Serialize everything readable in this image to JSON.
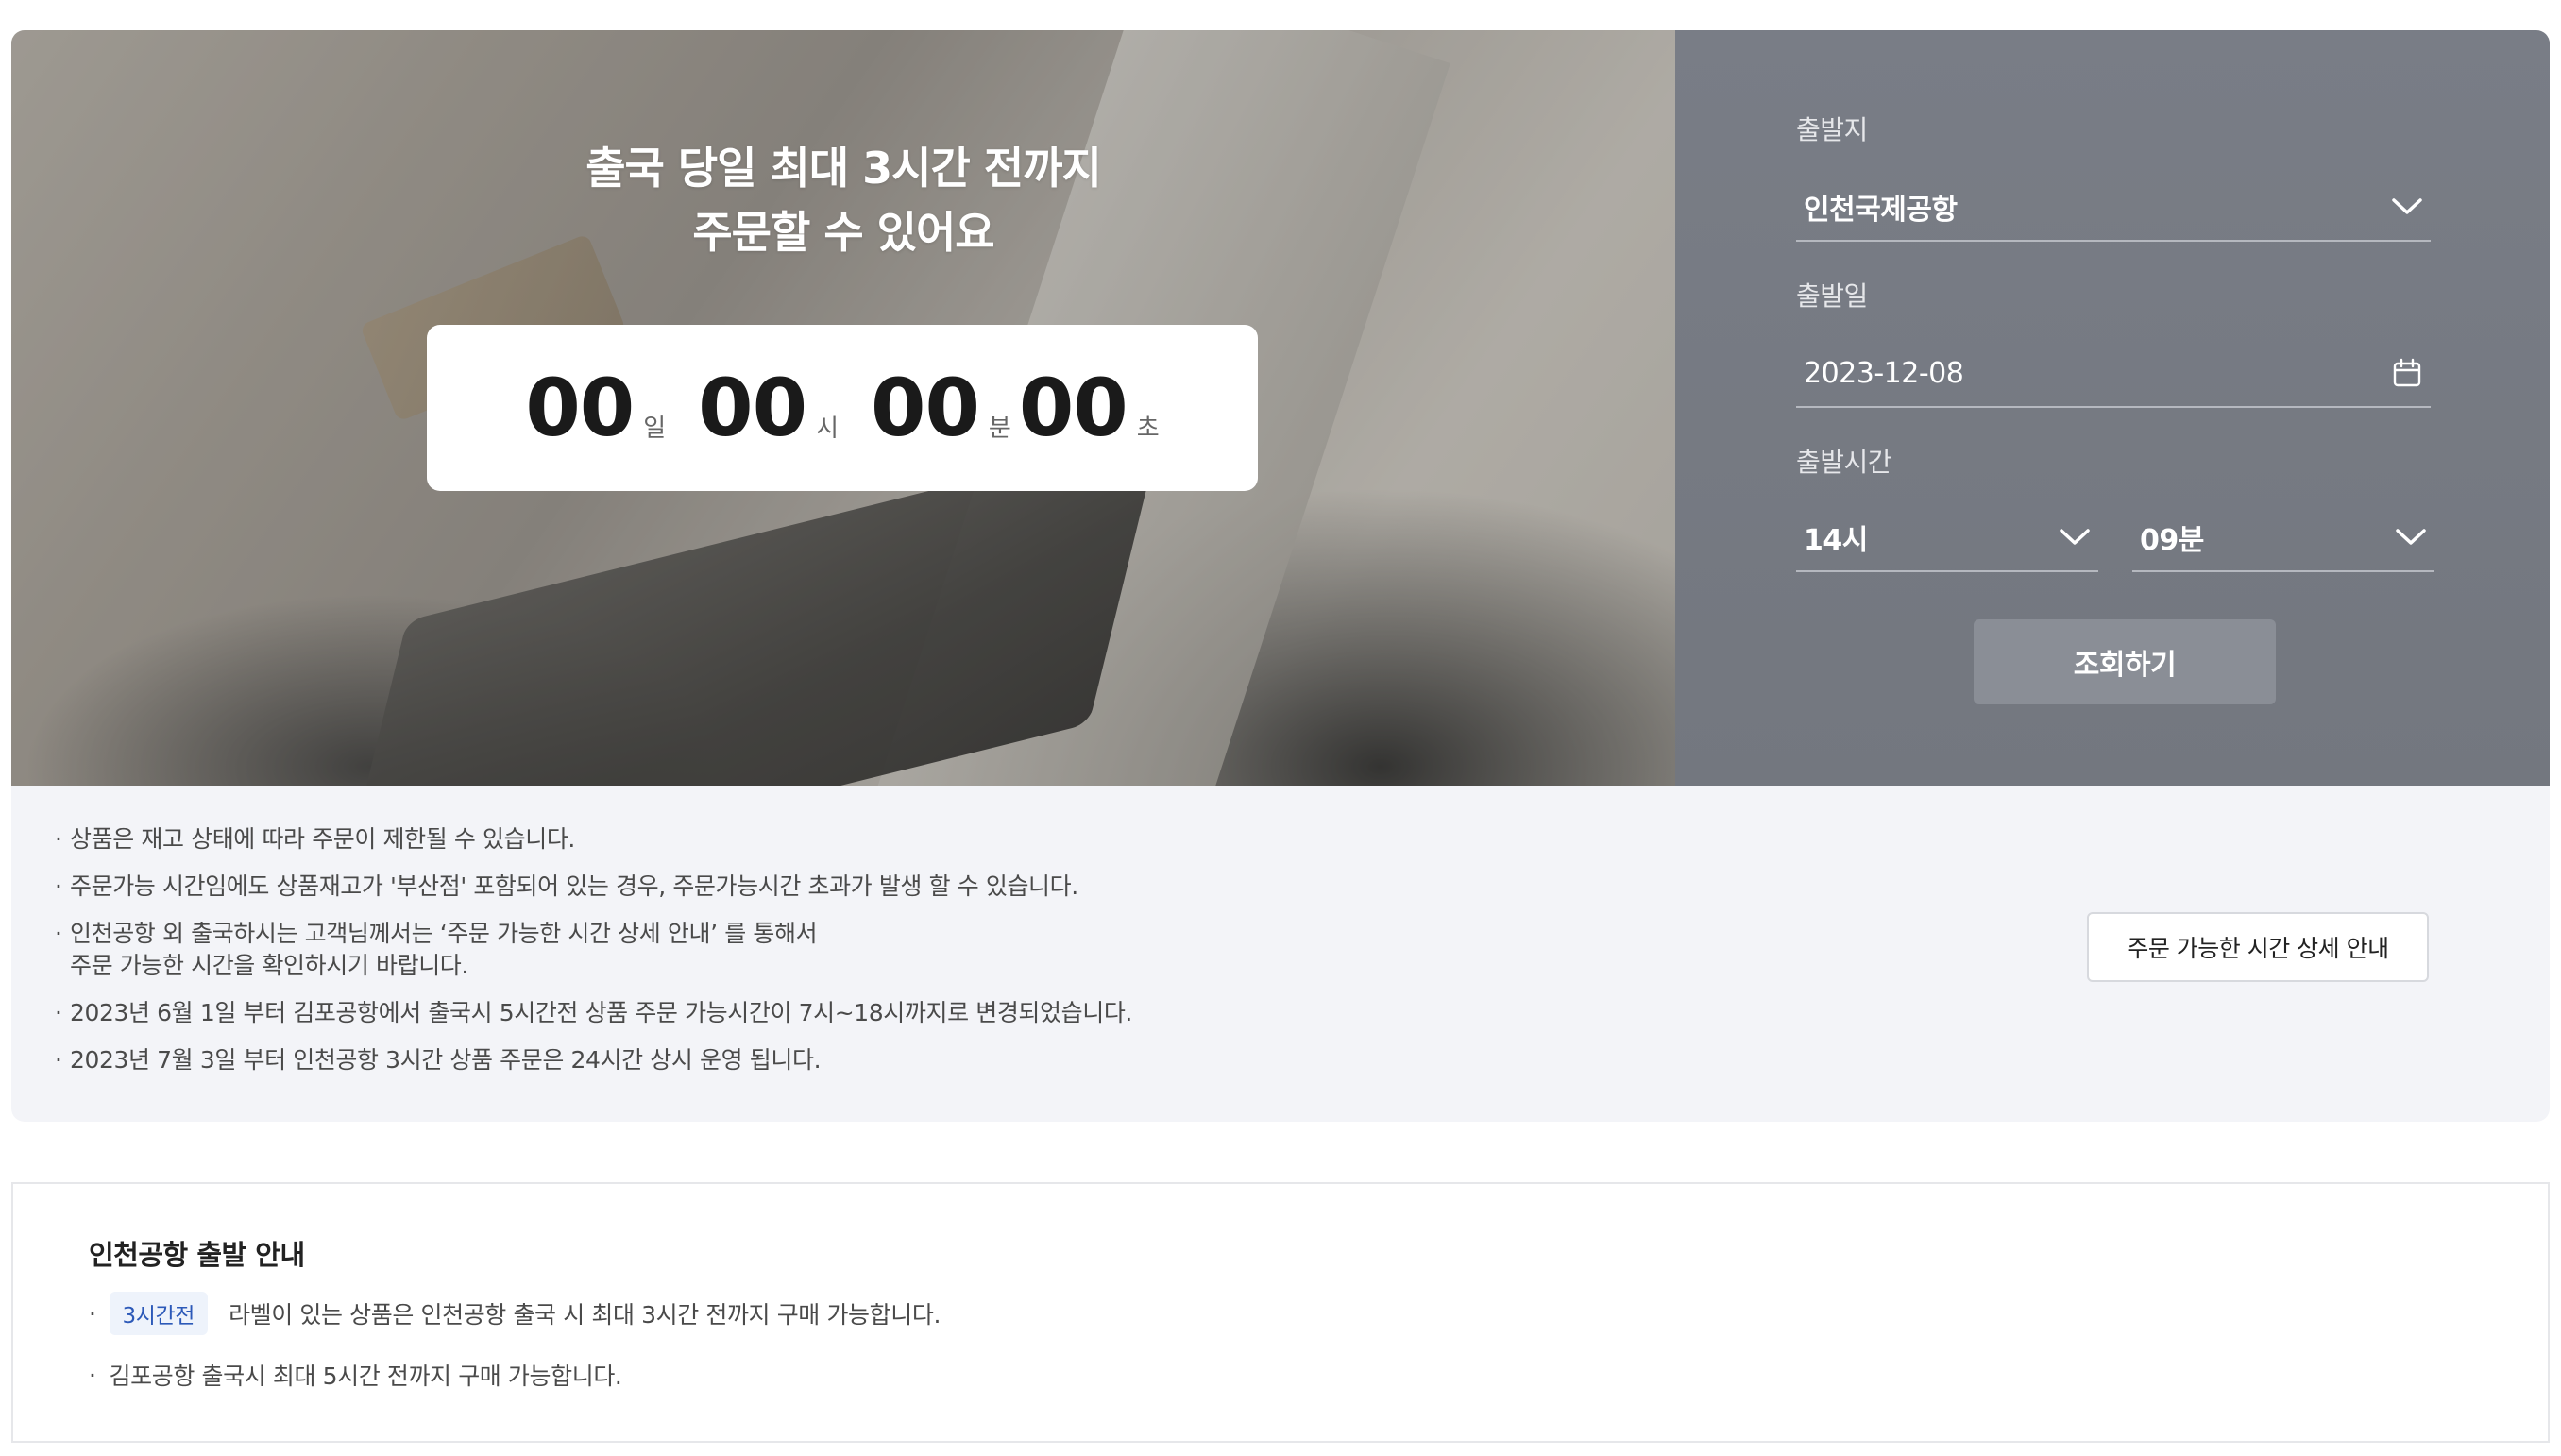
{
  "hero": {
    "title_line1": "출국 당일 최대 3시간 전까지",
    "title_line2": "주문할 수 있어요",
    "countdown": {
      "days": "00",
      "days_label": "일",
      "hours": "00",
      "hours_label": "시",
      "minutes": "00",
      "minutes_label": "분",
      "seconds": "00",
      "seconds_label": "초"
    }
  },
  "search": {
    "departure_label": "출발지",
    "departure_value": "인천국제공항",
    "date_label": "출발일",
    "date_value": "2023-12-08",
    "time_label": "출발시간",
    "hour_value": "14시",
    "minute_value": "09분",
    "submit_label": "조회하기"
  },
  "notice": {
    "items": [
      "상품은 재고 상태에 따라 주문이 제한될 수 있습니다.",
      "주문가능 시간임에도 상품재고가 '부산점' 포함되어 있는 경우, 주문가능시간 초과가 발생 할 수 있습니다.",
      "인천공항 외 출국하시는 고객님께서는 ‘주문 가능한 시간 상세 안내’ 를 통해서",
      "주문 가능한 시간을 확인하시기 바랍니다.",
      "2023년 6월 1일 부터 김포공항에서 출국시 5시간전 상품 주문 가능시간이 7시~18시까지로 변경되었습니다.",
      "2023년 7월 3일 부터 인천공항 3시간 상품 주문은 24시간 상시 운영 됩니다."
    ],
    "detail_button_label": "주문 가능한 시간 상세 안내"
  },
  "guide": {
    "title": "인천공항 출발 안내",
    "badge": "3시간전",
    "line1_text": "라벨이 있는 상품은 인천공항 출국 시 최대 3시간 전까지 구매 가능합니다.",
    "line2_text": "김포공항 출국시 최대 5시간 전까지 구매 가능합니다."
  },
  "icons": {
    "dropdown": "chevron-down-icon",
    "calendar": "calendar-icon"
  },
  "colors": {
    "panel_bg": "#797d86",
    "button_bg": "#8a8e96",
    "notice_bg": "#f3f4f8",
    "badge_text": "#2c59b8",
    "badge_bg": "#eef3fb"
  }
}
